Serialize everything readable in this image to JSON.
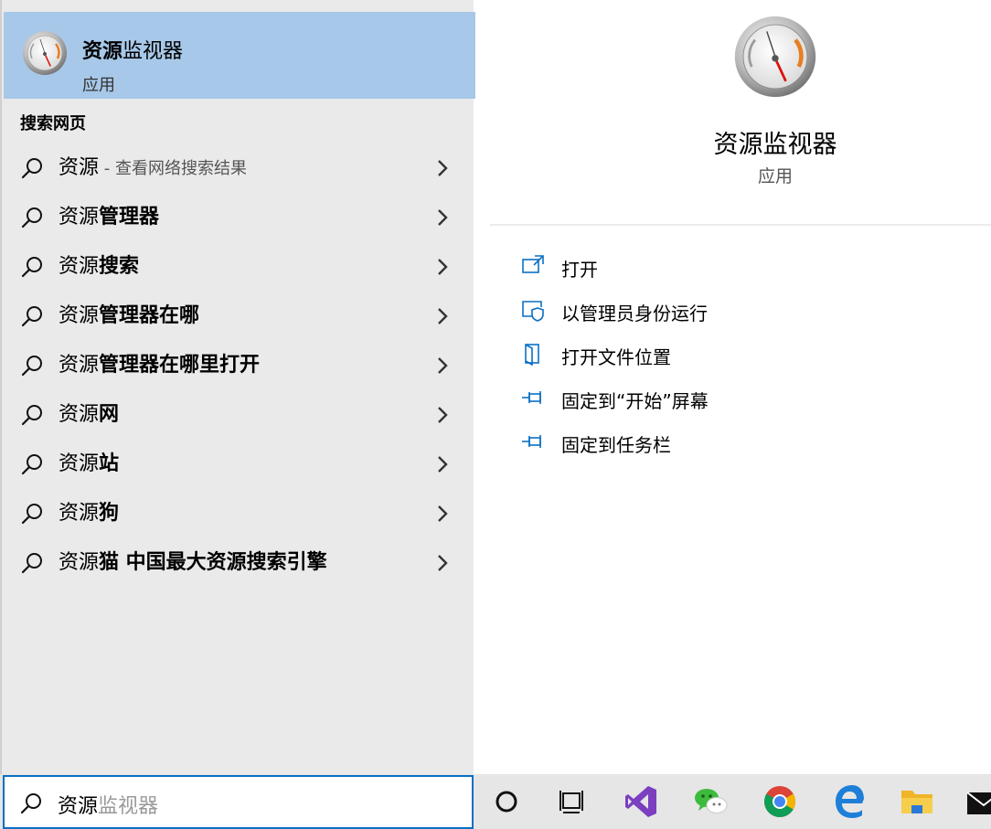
{
  "best_match": {
    "title_bold": "资源",
    "title_rest": "监视器",
    "subtitle": "应用",
    "icon": "resource-monitor-gauge-icon"
  },
  "web_section": {
    "header": "搜索网页",
    "items": [
      {
        "typed": "资源",
        "completion": "",
        "hint": " - 查看网络搜索结果"
      },
      {
        "typed": "资源",
        "completion": "管理器",
        "hint": ""
      },
      {
        "typed": "资源",
        "completion": "搜索",
        "hint": ""
      },
      {
        "typed": "资源",
        "completion": "管理器在哪",
        "hint": ""
      },
      {
        "typed": "资源",
        "completion": "管理器在哪里打开",
        "hint": ""
      },
      {
        "typed": "资源",
        "completion": "网",
        "hint": ""
      },
      {
        "typed": "资源",
        "completion": "站",
        "hint": ""
      },
      {
        "typed": "资源",
        "completion": "狗",
        "hint": ""
      },
      {
        "typed": "资源",
        "completion": "猫 中国最大资源搜索引擎",
        "hint": ""
      }
    ]
  },
  "detail": {
    "title": "资源监视器",
    "subtitle": "应用",
    "actions": [
      {
        "label": "打开",
        "icon": "open-icon"
      },
      {
        "label": "以管理员身份运行",
        "icon": "shield-run-icon"
      },
      {
        "label": "打开文件位置",
        "icon": "file-location-icon"
      },
      {
        "label": "固定到“开始”屏幕",
        "icon": "pin-icon"
      },
      {
        "label": "固定到任务栏",
        "icon": "pin-icon"
      }
    ]
  },
  "search": {
    "typed": "资源",
    "ghost": "监视器"
  },
  "taskbar": {
    "apps": [
      "cortana-icon",
      "task-view-icon",
      "visual-studio-icon",
      "wechat-icon",
      "chrome-icon",
      "edge-icon",
      "file-explorer-icon",
      "mail-icon"
    ]
  },
  "colors": {
    "accent": "#0b6fc4",
    "selected": "#a7c8e8",
    "pane_bg": "#eaeaea"
  }
}
